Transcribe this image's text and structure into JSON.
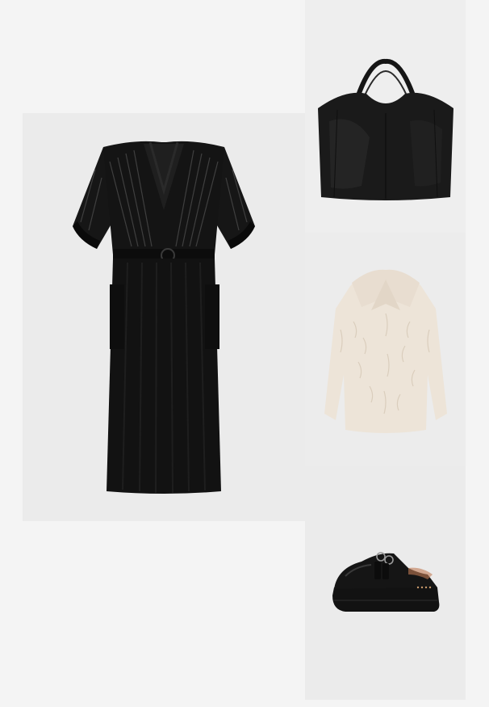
{
  "outfit": {
    "items": [
      {
        "name": "dress",
        "icon": "black-belted-midi-dress-image",
        "color": "#111111"
      },
      {
        "name": "bag",
        "icon": "black-leather-tote-bag-image",
        "color": "#1a1a1a"
      },
      {
        "name": "coat",
        "icon": "cream-faux-fur-jacket-image",
        "color": "#ede4d8"
      },
      {
        "name": "shoes",
        "icon": "black-chunky-mule-image",
        "color": "#121212"
      }
    ]
  }
}
